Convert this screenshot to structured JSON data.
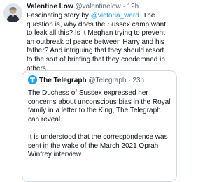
{
  "tweet": {
    "author_name": "Valentine Low",
    "author_handle": "@valentinelow",
    "separator": "·",
    "time": "12h",
    "text_before_mention": "Fascinating story by ",
    "mention": "@victoria_ward",
    "text_after_mention": ". The question is, why does the Sussex camp want to leak all this? Is it Meghan trying to prevent an outbreak of peace between Harry and his father? And intriguing that they should resort to the sort of briefing that they condemned in others."
  },
  "quoted_tweet": {
    "author_name": "The Telegraph",
    "author_handle": "@Telegraph",
    "separator": "·",
    "time": "23h",
    "paragraphs": [
      "The Duchess of Sussex expressed her concerns about unconscious bias in the Royal family in a letter to the King, The Telegraph can reveal.",
      "It is understood that the correspondence was sent in the wake of the March 2021 Oprah Winfrey interview"
    ]
  },
  "colors": {
    "text": "#0f1419",
    "secondary_text": "#536471",
    "link": "#1d9bf0",
    "border": "#cfd9de",
    "telegraph_logo_bg": "#1da1f2"
  },
  "icons": {
    "avatar": "author-avatar-photo",
    "quote_logo": "telegraph-logo-icon"
  }
}
